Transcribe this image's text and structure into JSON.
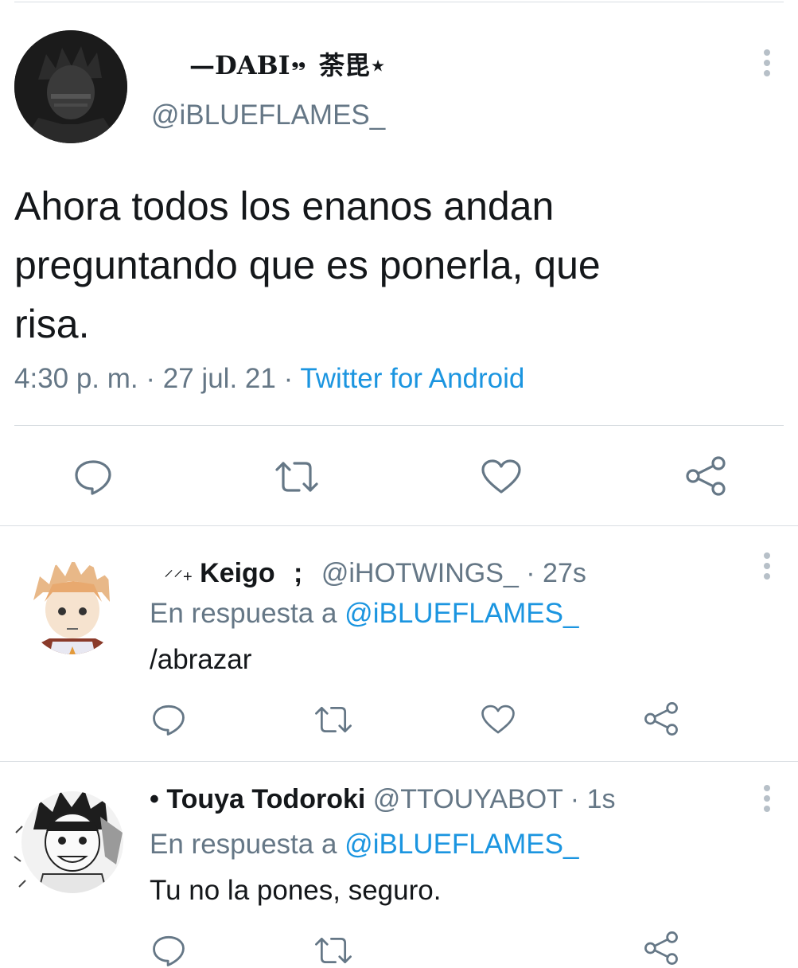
{
  "main_tweet": {
    "display_name": "—DABI",
    "name_glyph": "❟❟",
    "name_suffix": "荼毘⋆",
    "handle": "@iBLUEFLAMES_",
    "text_line1": "Ahora todos los enanos andan",
    "text_line2": "preguntando que es ponerla, que",
    "text_line3": "risa.",
    "time": "4:30 p. m.",
    "sep": "·",
    "date": "27 jul. 21",
    "source": "Twitter for Android"
  },
  "replies": [
    {
      "name_prefix": "⸝⸝",
      "name_plus": "+",
      "display_name": "Keigo",
      "name_suffix": ";",
      "handle": "@iHOTWINGS_",
      "sep": "·",
      "time_ago": "27s",
      "reply_prefix": "En respuesta a",
      "reply_to": "@iBLUEFLAMES_",
      "text": "/abrazar"
    },
    {
      "name_prefix": "•",
      "display_name": "Touya Todoroki",
      "handle": "@TTOUYABOT",
      "sep": "·",
      "time_ago": "1s",
      "reply_prefix": "En respuesta a",
      "reply_to": "@iBLUEFLAMES_",
      "text": "Tu no la pones, seguro."
    }
  ],
  "icons": {
    "reply": "reply-icon",
    "retweet": "retweet-icon",
    "like": "heart-icon",
    "share": "share-icon",
    "more": "more-vertical-icon"
  },
  "colors": {
    "link": "#1b95e0",
    "muted": "#657786",
    "text": "#14171a",
    "divider": "#d9dee2"
  }
}
